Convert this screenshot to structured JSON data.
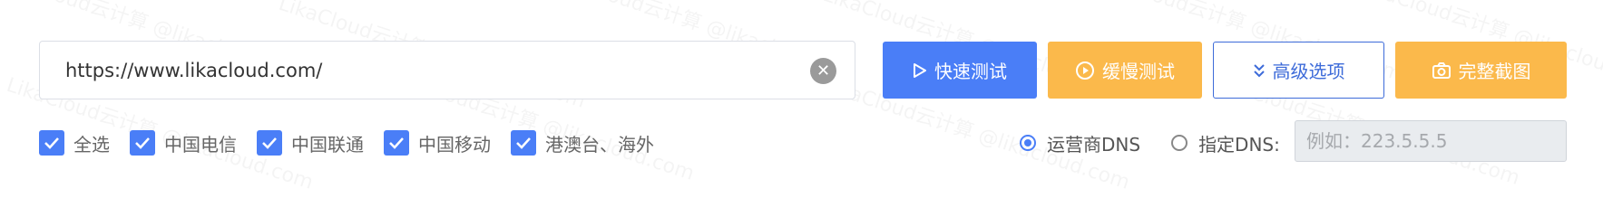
{
  "watermark": {
    "text": "LikaCloud云计算 @likacloud.com"
  },
  "url_input": {
    "value": "https://www.likacloud.com/",
    "clear_glyph": "✕"
  },
  "buttons": {
    "quick": {
      "label": "快速测试",
      "icon": "play-icon",
      "color": "#4a7ef7"
    },
    "slow": {
      "label": "缓慢测试",
      "icon": "play-circle-icon",
      "color": "#fbb94b"
    },
    "advanced": {
      "label": "高级选项",
      "icon": "double-chevron-down-icon",
      "color": "#3d6bd9"
    },
    "screenshot": {
      "label": "完整截图",
      "icon": "camera-icon",
      "color": "#fbb94b"
    }
  },
  "checkboxes": [
    {
      "label": "全选",
      "checked": true
    },
    {
      "label": "中国电信",
      "checked": true
    },
    {
      "label": "中国联通",
      "checked": true
    },
    {
      "label": "中国移动",
      "checked": true
    },
    {
      "label": "港澳台、海外",
      "checked": true
    }
  ],
  "dns": {
    "isp_label": "运营商DNS",
    "isp_selected": true,
    "custom_label": "指定DNS:",
    "custom_selected": false,
    "custom_placeholder": "例如：223.5.5.5"
  }
}
